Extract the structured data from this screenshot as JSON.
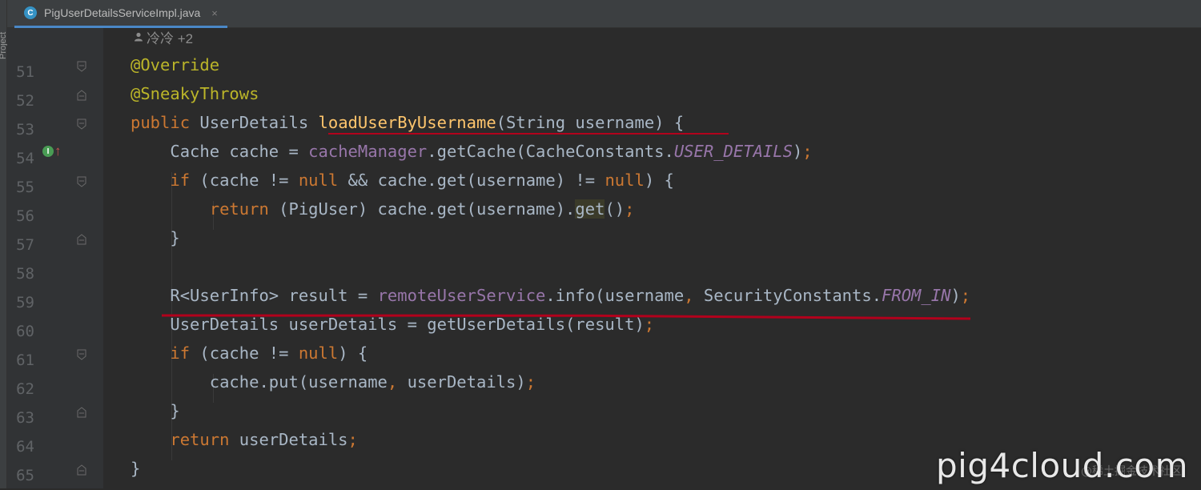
{
  "sidebar": {
    "label": "Project"
  },
  "tab": {
    "icon": "class-c-icon",
    "icon_letter": "C",
    "title": "PigUserDetailsServiceImpl.java",
    "close": "×"
  },
  "hint": {
    "authors": "冷冷 +2"
  },
  "gutter": {
    "lines": [
      "51",
      "52",
      "53",
      "54",
      "55",
      "56",
      "57",
      "58",
      "59",
      "60",
      "61",
      "62",
      "63",
      "64",
      "65"
    ],
    "implements_marker": {
      "icon": "implements-method-icon",
      "letter": "I"
    }
  },
  "code": {
    "l51_a": "@Override",
    "l52_a": "@SneakyThrows",
    "l53_kw": "public",
    "l53_type": " UserDetails ",
    "l53_fn": "loadUserByUsername",
    "l53_rest": "(String username) {",
    "l54_a": "    Cache cache = ",
    "l54_fld": "cacheManager",
    "l54_b": ".getCache(CacheConstants.",
    "l54_sfld": "USER_DETAILS",
    "l54_c": ")",
    "l54_semi": ";",
    "l55_kw1": "    if",
    "l55_a": " (cache != ",
    "l55_kw2": "null",
    "l55_b": " && cache.get(username) != ",
    "l55_kw3": "null",
    "l55_c": ") {",
    "l56_kw": "        return",
    "l56_a": " (PigUser) cache.get(username).",
    "l56_hl": "get",
    "l56_b": "()",
    "l56_semi": ";",
    "l57_a": "    }",
    "l59_a": "    R<UserInfo> result = ",
    "l59_fld": "remoteUserService",
    "l59_b": ".info(username",
    "l59_comma": ",",
    "l59_c": " SecurityConstants.",
    "l59_sfld": "FROM_IN",
    "l59_d": ")",
    "l59_semi": ";",
    "l60_a": "    UserDetails userDetails = getUserDetails(result)",
    "l60_semi": ";",
    "l61_kw1": "    if",
    "l61_a": " (cache != ",
    "l61_kw2": "null",
    "l61_b": ") {",
    "l62_a": "        cache.put(username",
    "l62_comma": ",",
    "l62_b": " userDetails)",
    "l62_semi": ";",
    "l63_a": "    }",
    "l64_kw": "    return",
    "l64_a": " userDetails",
    "l64_semi": ";",
    "l65_a": "}"
  },
  "watermark": {
    "main": "pig4cloud.com",
    "sub": "@稀土掘金技术社区"
  },
  "colors": {
    "background": "#2b2b2b",
    "keyword": "#cc7832",
    "annotation": "#bbb529",
    "field": "#9876aa",
    "method_decl": "#ffc66d",
    "text": "#a9b7c6",
    "underline": "#b2001c"
  }
}
